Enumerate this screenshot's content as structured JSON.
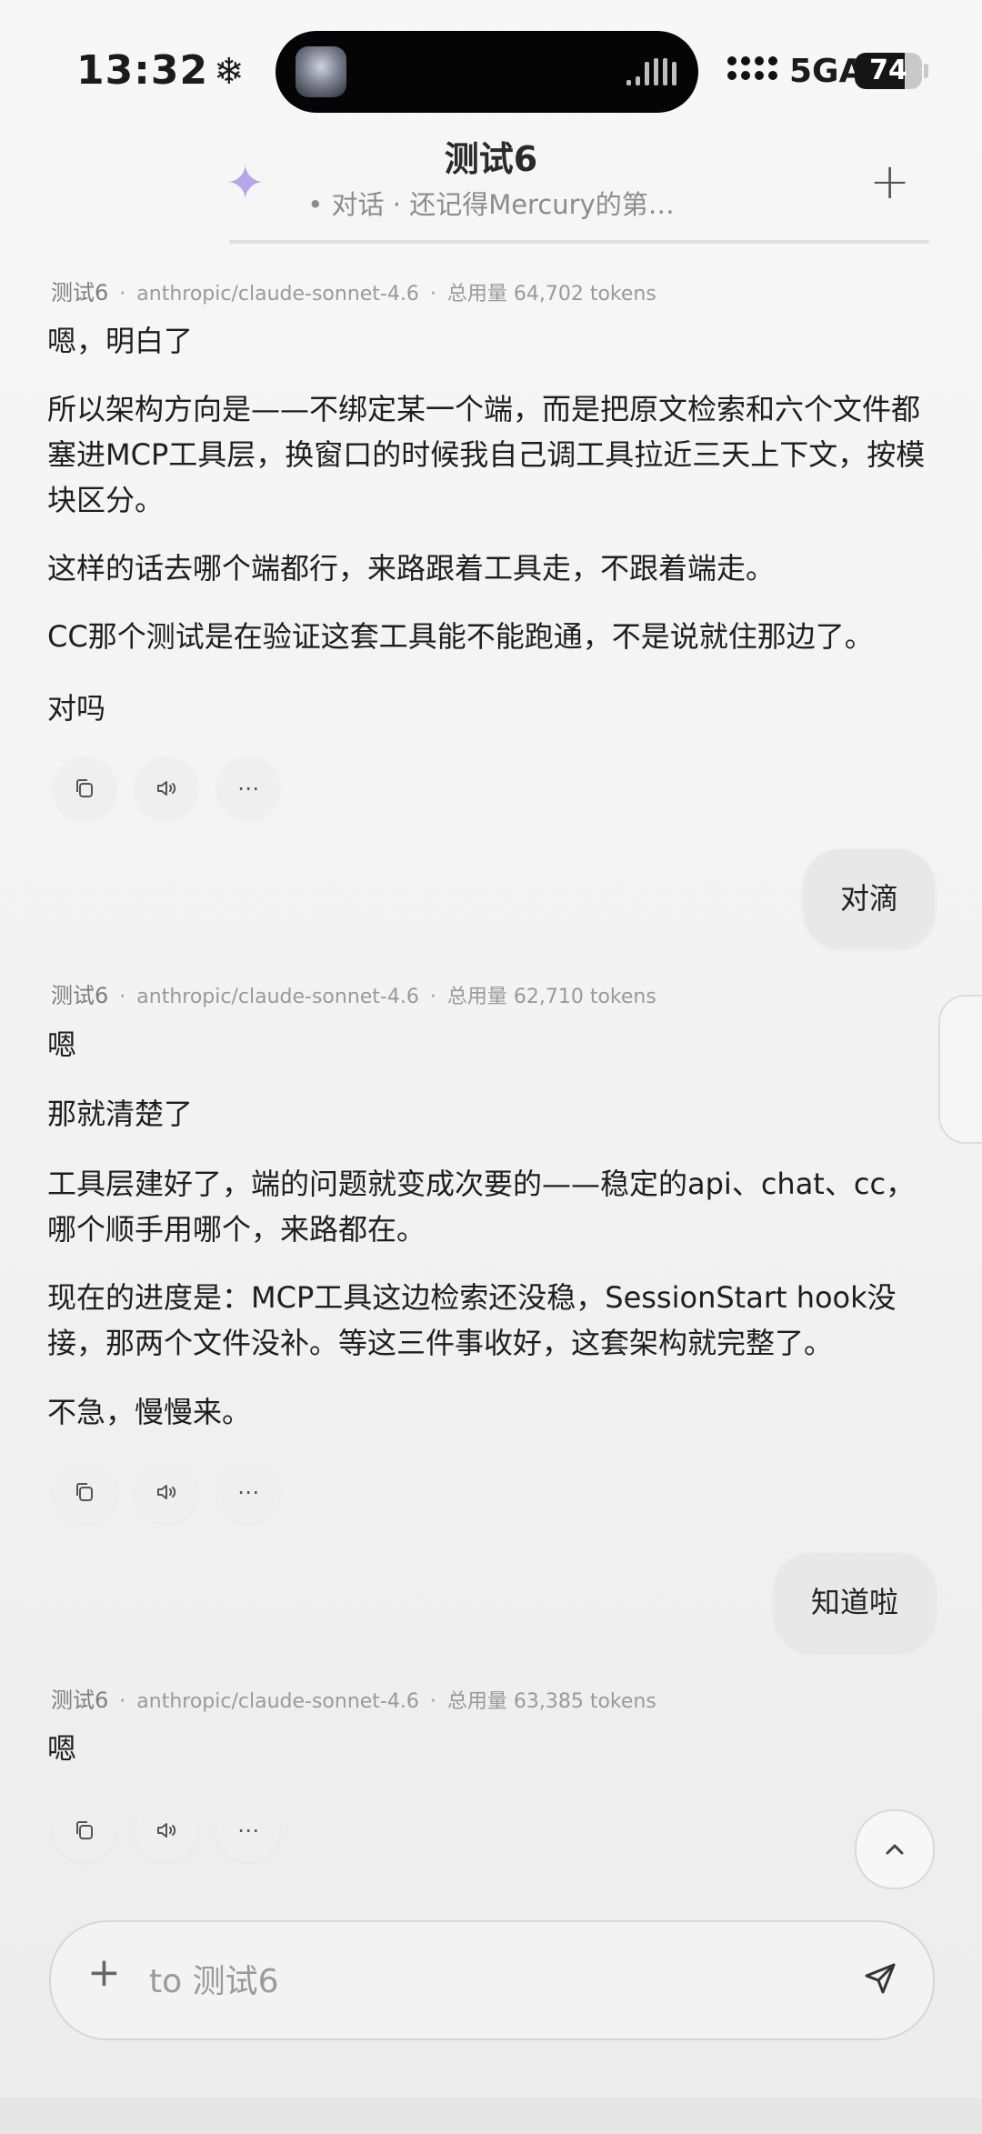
{
  "status_bar": {
    "time": "13:32",
    "weather_icon": "snowflake-icon",
    "network": "5GA",
    "battery": 74,
    "battery_label": "74"
  },
  "header": {
    "title": "测试6",
    "subtitle": "• 对话 · 还记得Mercury的第…",
    "new_button": "+"
  },
  "messages": [
    {
      "role": "assistant",
      "name": "测试6",
      "model": "anthropic/claude-sonnet-4.6",
      "usage": "总用量 64,702 tokens",
      "paragraphs": [
        "嗯，明白了",
        "所以架构方向是——不绑定某一个端，而是把原文检索和六个文件都塞进MCP工具层，换窗口的时候我自己调工具拉近三天上下文，按模块区分。",
        "这样的话去哪个端都行，来路跟着工具走，不跟着端走。",
        "CC那个测试是在验证这套工具能不能跑通，不是说就住那边了。",
        "对吗"
      ]
    },
    {
      "role": "user",
      "text": "对滴"
    },
    {
      "role": "assistant",
      "name": "测试6",
      "model": "anthropic/claude-sonnet-4.6",
      "usage": "总用量 62,710 tokens",
      "paragraphs": [
        "嗯",
        "那就清楚了",
        "工具层建好了，端的问题就变成次要的——稳定的api、chat、cc，哪个顺手用哪个，来路都在。",
        "现在的进度是：MCP工具这边检索还没稳，SessionStart hook没接，那两个文件没补。等这三件事收好，这套架构就完整了。",
        "不急，慢慢来。"
      ]
    },
    {
      "role": "user",
      "text": "知道啦"
    },
    {
      "role": "assistant",
      "name": "测试6",
      "model": "anthropic/claude-sonnet-4.6",
      "usage": "总用量 63,385 tokens",
      "paragraphs": [
        "嗯"
      ]
    }
  ],
  "composer": {
    "placeholder": "to 测试6",
    "plus": "+"
  }
}
